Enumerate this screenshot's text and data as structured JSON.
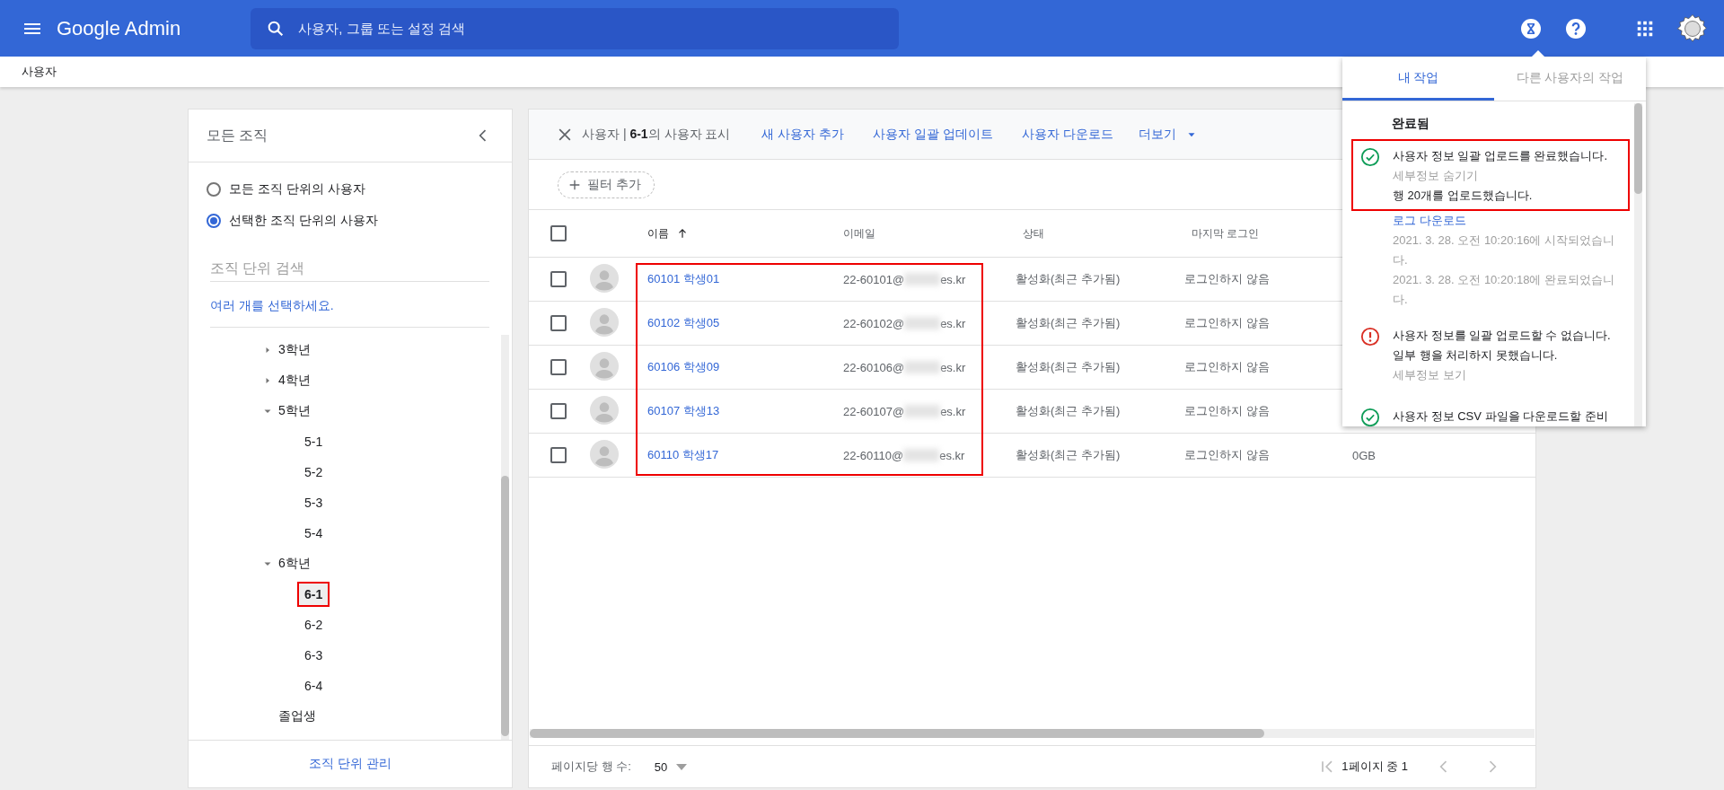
{
  "topbar": {
    "product": "Google Admin",
    "search": {
      "placeholder": "사용자, 그룹 또는 설정 검색"
    }
  },
  "breadcrumb": "사용자",
  "org_panel": {
    "title": "모든 조직",
    "scope_options": [
      {
        "label": "모든 조직 단위의 사용자",
        "selected": false
      },
      {
        "label": "선택한 조직 단위의 사용자",
        "selected": true
      }
    ],
    "search": {
      "placeholder": "조직 단위 검색"
    },
    "multi_select_link": "여러 개를 선택하세요.",
    "tree": [
      {
        "label": "3학년",
        "expanded": false,
        "selected": false
      },
      {
        "label": "4학년",
        "expanded": false,
        "selected": false
      },
      {
        "label": "5학년",
        "expanded": true,
        "selected": false,
        "children": [
          {
            "label": "5-1",
            "selected": false
          },
          {
            "label": "5-2",
            "selected": false
          },
          {
            "label": "5-3",
            "selected": false
          },
          {
            "label": "5-4",
            "selected": false
          }
        ]
      },
      {
        "label": "6학년",
        "expanded": true,
        "selected": false,
        "children": [
          {
            "label": "6-1",
            "selected": true,
            "highlighted": true
          },
          {
            "label": "6-2",
            "selected": false
          },
          {
            "label": "6-3",
            "selected": false
          },
          {
            "label": "6-4",
            "selected": false
          }
        ]
      },
      {
        "label": "졸업생",
        "selected": false
      }
    ],
    "footer_link": "조직 단위 관리"
  },
  "users_panel": {
    "title": "사용자 | **6-1**의 사용자 표시",
    "actions": [
      "새 사용자 추가",
      "사용자 일괄 업데이트",
      "사용자 다운로드"
    ],
    "more": "더보기",
    "filter_chip": "필터 추가",
    "table": {
      "columns": [
        {
          "label": "이름",
          "sorted": true
        },
        {
          "label": "이메일",
          "sorted": false
        },
        {
          "label": "상태",
          "sorted": false
        },
        {
          "label": "마지막 로그인",
          "sorted": false
        }
      ],
      "header_checked": false,
      "name_column_highlighted": true,
      "rows": [
        {
          "checked": false,
          "name": "60101 학생01",
          "email_start": "22-60101@",
          "email_end": "es.kr",
          "status": "활성화(최근 추가됨)",
          "last_login": "로그인하지 않음"
        },
        {
          "checked": false,
          "name": "60102 학생05",
          "email_start": "22-60102@",
          "email_end": "es.kr",
          "status": "활성화(최근 추가됨)",
          "last_login": "로그인하지 않음"
        },
        {
          "checked": false,
          "name": "60106 학생09",
          "email_start": "22-60106@",
          "email_end": "es.kr",
          "status": "활성화(최근 추가됨)",
          "last_login": "로그인하지 않음"
        },
        {
          "checked": false,
          "name": "60107 학생13",
          "email_start": "22-60107@",
          "email_end": "es.kr",
          "status": "활성화(최근 추가됨)",
          "last_login": "로그인하지 않음"
        },
        {
          "checked": false,
          "name": "60110 학생17",
          "email_start": "22-60110@",
          "email_end": "es.kr",
          "status": "활성화(최근 추가됨)",
          "last_login": "로그인하지 않음",
          "storage": "0GB"
        }
      ]
    },
    "pagination": {
      "rows_per_page_label": "페이지당 행 수:",
      "rows_per_page": "50",
      "page_info": "1페이지 중 1"
    }
  },
  "tasks_panel": {
    "tabs": [
      {
        "label": "내 작업",
        "selected": true
      },
      {
        "label": "다른 사용자의 작업",
        "selected": false
      }
    ],
    "section": "완료됨",
    "tasks": [
      {
        "kind": "success",
        "highlighted": true,
        "message": "사용자 정보 일괄 업로드를 완료했습니다.",
        "detail_toggle": "세부정보 숨기기",
        "details": [
          "행 20개를 업로드했습니다."
        ],
        "link": "로그 다운로드",
        "times": [
          "2021. 3. 28. 오전 10:20:16에 시작되었습니다.",
          "2021. 3. 28. 오전 10:20:18에 완료되었습니다."
        ]
      },
      {
        "kind": "error",
        "highlighted": false,
        "message": "사용자 정보를 일괄 업로드할 수 없습니다. 일부 행을 처리하지 못했습니다.",
        "detail_toggle": "세부정보 보기"
      },
      {
        "kind": "success",
        "highlighted": false,
        "message": "사용자 정보 CSV 파일을 다운로드할 준비"
      }
    ]
  }
}
